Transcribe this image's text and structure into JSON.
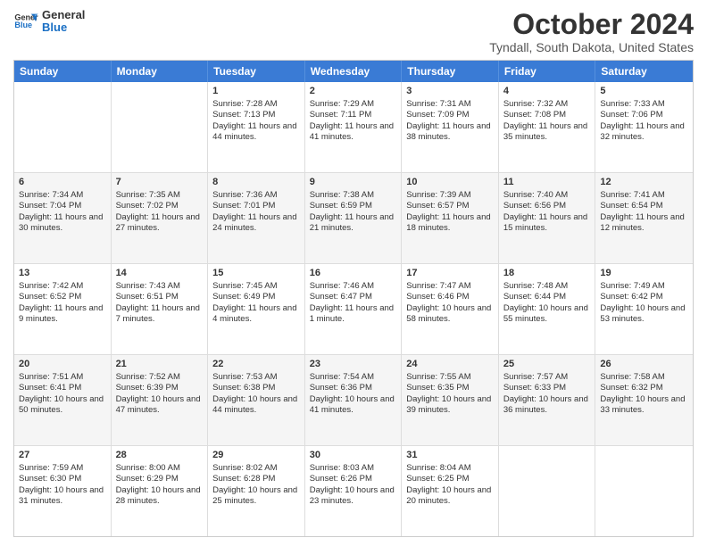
{
  "header": {
    "logo": {
      "line1": "General",
      "line2": "Blue"
    },
    "title": "October 2024",
    "subtitle": "Tyndall, South Dakota, United States"
  },
  "days_of_week": [
    "Sunday",
    "Monday",
    "Tuesday",
    "Wednesday",
    "Thursday",
    "Friday",
    "Saturday"
  ],
  "rows": [
    {
      "alt": false,
      "cells": [
        {
          "day": "",
          "info": ""
        },
        {
          "day": "",
          "info": ""
        },
        {
          "day": "1",
          "info": "Sunrise: 7:28 AM\nSunset: 7:13 PM\nDaylight: 11 hours and 44 minutes."
        },
        {
          "day": "2",
          "info": "Sunrise: 7:29 AM\nSunset: 7:11 PM\nDaylight: 11 hours and 41 minutes."
        },
        {
          "day": "3",
          "info": "Sunrise: 7:31 AM\nSunset: 7:09 PM\nDaylight: 11 hours and 38 minutes."
        },
        {
          "day": "4",
          "info": "Sunrise: 7:32 AM\nSunset: 7:08 PM\nDaylight: 11 hours and 35 minutes."
        },
        {
          "day": "5",
          "info": "Sunrise: 7:33 AM\nSunset: 7:06 PM\nDaylight: 11 hours and 32 minutes."
        }
      ]
    },
    {
      "alt": true,
      "cells": [
        {
          "day": "6",
          "info": "Sunrise: 7:34 AM\nSunset: 7:04 PM\nDaylight: 11 hours and 30 minutes."
        },
        {
          "day": "7",
          "info": "Sunrise: 7:35 AM\nSunset: 7:02 PM\nDaylight: 11 hours and 27 minutes."
        },
        {
          "day": "8",
          "info": "Sunrise: 7:36 AM\nSunset: 7:01 PM\nDaylight: 11 hours and 24 minutes."
        },
        {
          "day": "9",
          "info": "Sunrise: 7:38 AM\nSunset: 6:59 PM\nDaylight: 11 hours and 21 minutes."
        },
        {
          "day": "10",
          "info": "Sunrise: 7:39 AM\nSunset: 6:57 PM\nDaylight: 11 hours and 18 minutes."
        },
        {
          "day": "11",
          "info": "Sunrise: 7:40 AM\nSunset: 6:56 PM\nDaylight: 11 hours and 15 minutes."
        },
        {
          "day": "12",
          "info": "Sunrise: 7:41 AM\nSunset: 6:54 PM\nDaylight: 11 hours and 12 minutes."
        }
      ]
    },
    {
      "alt": false,
      "cells": [
        {
          "day": "13",
          "info": "Sunrise: 7:42 AM\nSunset: 6:52 PM\nDaylight: 11 hours and 9 minutes."
        },
        {
          "day": "14",
          "info": "Sunrise: 7:43 AM\nSunset: 6:51 PM\nDaylight: 11 hours and 7 minutes."
        },
        {
          "day": "15",
          "info": "Sunrise: 7:45 AM\nSunset: 6:49 PM\nDaylight: 11 hours and 4 minutes."
        },
        {
          "day": "16",
          "info": "Sunrise: 7:46 AM\nSunset: 6:47 PM\nDaylight: 11 hours and 1 minute."
        },
        {
          "day": "17",
          "info": "Sunrise: 7:47 AM\nSunset: 6:46 PM\nDaylight: 10 hours and 58 minutes."
        },
        {
          "day": "18",
          "info": "Sunrise: 7:48 AM\nSunset: 6:44 PM\nDaylight: 10 hours and 55 minutes."
        },
        {
          "day": "19",
          "info": "Sunrise: 7:49 AM\nSunset: 6:42 PM\nDaylight: 10 hours and 53 minutes."
        }
      ]
    },
    {
      "alt": true,
      "cells": [
        {
          "day": "20",
          "info": "Sunrise: 7:51 AM\nSunset: 6:41 PM\nDaylight: 10 hours and 50 minutes."
        },
        {
          "day": "21",
          "info": "Sunrise: 7:52 AM\nSunset: 6:39 PM\nDaylight: 10 hours and 47 minutes."
        },
        {
          "day": "22",
          "info": "Sunrise: 7:53 AM\nSunset: 6:38 PM\nDaylight: 10 hours and 44 minutes."
        },
        {
          "day": "23",
          "info": "Sunrise: 7:54 AM\nSunset: 6:36 PM\nDaylight: 10 hours and 41 minutes."
        },
        {
          "day": "24",
          "info": "Sunrise: 7:55 AM\nSunset: 6:35 PM\nDaylight: 10 hours and 39 minutes."
        },
        {
          "day": "25",
          "info": "Sunrise: 7:57 AM\nSunset: 6:33 PM\nDaylight: 10 hours and 36 minutes."
        },
        {
          "day": "26",
          "info": "Sunrise: 7:58 AM\nSunset: 6:32 PM\nDaylight: 10 hours and 33 minutes."
        }
      ]
    },
    {
      "alt": false,
      "cells": [
        {
          "day": "27",
          "info": "Sunrise: 7:59 AM\nSunset: 6:30 PM\nDaylight: 10 hours and 31 minutes."
        },
        {
          "day": "28",
          "info": "Sunrise: 8:00 AM\nSunset: 6:29 PM\nDaylight: 10 hours and 28 minutes."
        },
        {
          "day": "29",
          "info": "Sunrise: 8:02 AM\nSunset: 6:28 PM\nDaylight: 10 hours and 25 minutes."
        },
        {
          "day": "30",
          "info": "Sunrise: 8:03 AM\nSunset: 6:26 PM\nDaylight: 10 hours and 23 minutes."
        },
        {
          "day": "31",
          "info": "Sunrise: 8:04 AM\nSunset: 6:25 PM\nDaylight: 10 hours and 20 minutes."
        },
        {
          "day": "",
          "info": ""
        },
        {
          "day": "",
          "info": ""
        }
      ]
    }
  ]
}
